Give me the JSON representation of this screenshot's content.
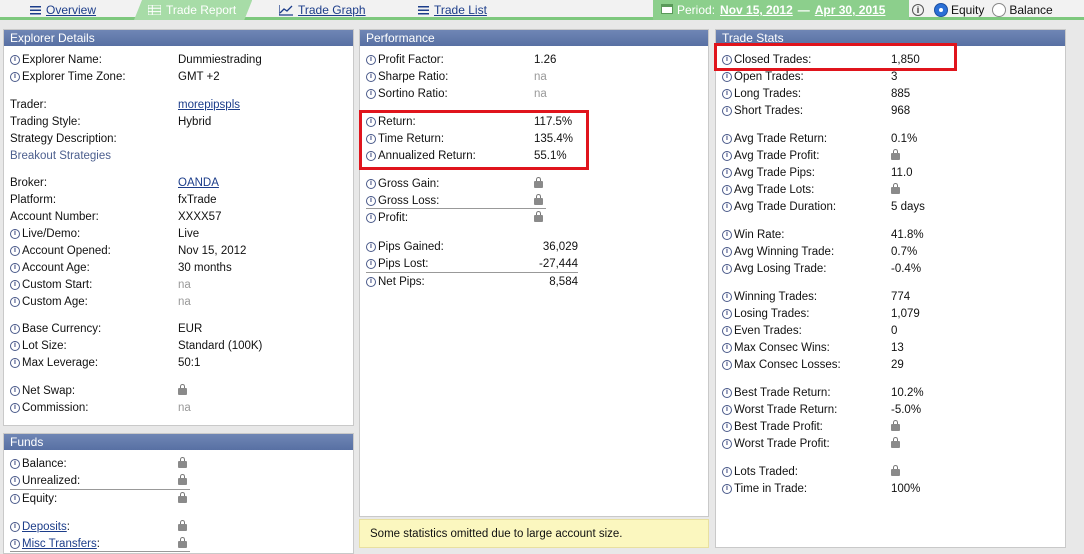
{
  "tabs": [
    {
      "label": "Overview",
      "icon": "list-icon",
      "active": false
    },
    {
      "label": "Trade Report",
      "icon": "grid-icon",
      "active": true
    },
    {
      "label": "Trade Graph",
      "icon": "line-chart-icon",
      "active": false
    },
    {
      "label": "Trade List",
      "icon": "list-icon",
      "active": false
    }
  ],
  "period": {
    "label": "Period:",
    "start": "Nov 15, 2012",
    "sep": "—",
    "end": "Apr 30, 2015"
  },
  "view_mode": {
    "options": [
      "Equity",
      "Balance"
    ],
    "selected": "Equity"
  },
  "colors": {
    "header": "#6f86b5",
    "tab_active": "#a7dca7",
    "period_bg": "#8ccf8c",
    "highlight": "#e0141c",
    "notice_bg": "#fbf7bf"
  },
  "explorer": {
    "title": "Explorer Details",
    "rows": [
      {
        "label": "Explorer Name:",
        "value": "Dummiestrading",
        "icon": true
      },
      {
        "label": "Explorer Time Zone:",
        "value": "GMT +2",
        "icon": true
      },
      {
        "label": "Trader:",
        "value": "morepipspls",
        "link": true
      },
      {
        "label": "Trading Style:",
        "value": "Hybrid"
      },
      {
        "label": "Strategy Description:",
        "value": ""
      },
      {
        "label": "Breakout Strategies",
        "value": "",
        "blue": true
      },
      {
        "label": "Broker:",
        "value": "OANDA",
        "link": true
      },
      {
        "label": "Platform:",
        "value": "fxTrade"
      },
      {
        "label": "Account Number:",
        "value": "XXXX57"
      },
      {
        "label": "Live/Demo:",
        "value": "Live",
        "icon": true
      },
      {
        "label": "Account Opened:",
        "value": "Nov 15, 2012",
        "icon": true
      },
      {
        "label": "Account Age:",
        "value": "30 months",
        "icon": true
      },
      {
        "label": "Custom Start:",
        "value": "na",
        "icon": true,
        "na": true
      },
      {
        "label": "Custom Age:",
        "value": "na",
        "icon": true,
        "na": true
      },
      {
        "label": "Base Currency:",
        "value": "EUR",
        "icon": true
      },
      {
        "label": "Lot Size:",
        "value": "Standard (100K)",
        "icon": true
      },
      {
        "label": "Max Leverage:",
        "value": "50:1",
        "icon": true
      },
      {
        "label": "Net Swap:",
        "value": "",
        "icon": true,
        "lock": true
      },
      {
        "label": "Commission:",
        "value": "na",
        "icon": true,
        "na": true
      }
    ]
  },
  "funds": {
    "title": "Funds",
    "rows": [
      {
        "label": "Balance:",
        "icon": true,
        "lock": true
      },
      {
        "label": "Unrealized:",
        "icon": true,
        "lock": true
      },
      {
        "label": "Equity:",
        "icon": true,
        "lock": true
      },
      {
        "label": "Deposits",
        "suffix": ":",
        "icon": true,
        "lock": true,
        "link": true
      },
      {
        "label": "Misc Transfers",
        "suffix": ":",
        "icon": true,
        "lock": true,
        "link": true
      }
    ]
  },
  "performance": {
    "title": "Performance",
    "rows": [
      {
        "label": "Profit Factor:",
        "value": "1.26"
      },
      {
        "label": "Sharpe Ratio:",
        "value": "na",
        "na": true
      },
      {
        "label": "Sortino Ratio:",
        "value": "na",
        "na": true
      },
      {
        "label": "Return:",
        "value": "117.5%"
      },
      {
        "label": "Time Return:",
        "value": "135.4%"
      },
      {
        "label": "Annualized Return:",
        "value": "55.1%"
      },
      {
        "label": "Gross Gain:",
        "lock": true
      },
      {
        "label": "Gross Loss:",
        "lock": true
      },
      {
        "label": "Profit:",
        "lock": true
      },
      {
        "label": "Pips Gained:",
        "value": "36,029"
      },
      {
        "label": "Pips Lost:",
        "value": "-27,444"
      },
      {
        "label": "Net Pips:",
        "value": "8,584"
      }
    ],
    "notice": "Some statistics omitted due to large account size."
  },
  "trade_stats": {
    "title": "Trade Stats",
    "rows": [
      {
        "label": "Closed Trades:",
        "value": "1,850"
      },
      {
        "label": "Open Trades:",
        "value": "3"
      },
      {
        "label": "Long Trades:",
        "value": "885"
      },
      {
        "label": "Short Trades:",
        "value": "968"
      },
      {
        "label": "Avg Trade Return:",
        "value": "0.1%"
      },
      {
        "label": "Avg Trade Profit:",
        "lock": true
      },
      {
        "label": "Avg Trade Pips:",
        "value": "11.0"
      },
      {
        "label": "Avg Trade Lots:",
        "lock": true
      },
      {
        "label": "Avg Trade Duration:",
        "value": "5 days"
      },
      {
        "label": "Win Rate:",
        "value": "41.8%"
      },
      {
        "label": "Avg Winning Trade:",
        "value": "0.7%"
      },
      {
        "label": "Avg Losing Trade:",
        "value": "-0.4%"
      },
      {
        "label": "Winning Trades:",
        "value": "774"
      },
      {
        "label": "Losing Trades:",
        "value": "1,079"
      },
      {
        "label": "Even Trades:",
        "value": "0"
      },
      {
        "label": "Max Consec Wins:",
        "value": "13"
      },
      {
        "label": "Max Consec Losses:",
        "value": "29"
      },
      {
        "label": "Best Trade Return:",
        "value": "10.2%"
      },
      {
        "label": "Worst Trade Return:",
        "value": "-5.0%"
      },
      {
        "label": "Best Trade Profit:",
        "lock": true
      },
      {
        "label": "Worst Trade Profit:",
        "lock": true
      },
      {
        "label": "Lots Traded:",
        "lock": true
      },
      {
        "label": "Time in Trade:",
        "value": "100%"
      }
    ]
  }
}
